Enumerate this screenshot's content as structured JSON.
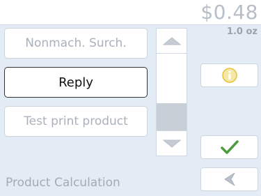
{
  "header": {
    "price": "$0.48",
    "weight": "1.0 oz"
  },
  "options": [
    {
      "label": "Nonmach. Surch."
    },
    {
      "label": "Reply"
    },
    {
      "label": "Test print product"
    }
  ],
  "footer": {
    "title": "Product Calculation"
  },
  "icons": {
    "scroll_up": "triangle-up-icon",
    "scroll_down": "triangle-down-icon",
    "info": "info-icon",
    "confirm": "checkmark-icon",
    "back": "back-arrow-icon"
  },
  "colors": {
    "accent_green": "#4d9c3c",
    "info_yellow": "#e5c33b"
  }
}
